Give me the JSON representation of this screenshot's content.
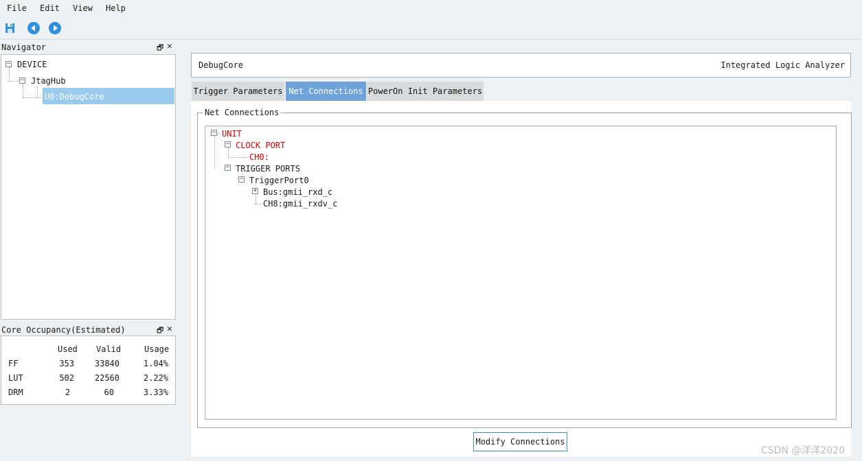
{
  "menu": {
    "file": "File",
    "edit": "Edit",
    "view": "View",
    "help": "Help"
  },
  "toolbar": {
    "save_icon": "floppy-disk-icon",
    "back_icon": "arrow-left-circle-icon",
    "forward_icon": "arrow-right-circle-icon",
    "accent": "#2f8fe0"
  },
  "navigator": {
    "title": "Navigator",
    "tree": {
      "device": "DEVICE",
      "hub": "JtagHub",
      "core": "U0:DebugCore"
    }
  },
  "occupancy": {
    "title": "Core Occupancy(Estimated)",
    "headers": [
      "Used",
      "Valid",
      "Usage"
    ],
    "rows": [
      {
        "name": "FF",
        "used": "353",
        "valid": "33840",
        "usage": "1.04%"
      },
      {
        "name": "LUT",
        "used": "502",
        "valid": "22560",
        "usage": "2.22%"
      },
      {
        "name": "DRM",
        "used": "2",
        "valid": "60",
        "usage": "3.33%"
      }
    ]
  },
  "header": {
    "left": "DebugCore",
    "right": "Integrated Logic Analyzer"
  },
  "tabs": [
    "Trigger Parameters",
    "Net Connections",
    "PowerOn Init Parameters"
  ],
  "net_connections": {
    "group_title": "Net Connections",
    "tree": {
      "unit": "UNIT",
      "clock_port": "CLOCK PORT",
      "ch0": "CH0:",
      "trigger_ports": "TRIGGER PORTS",
      "trigger_port0": "TriggerPort0",
      "bus": "Bus:gmii_rxd_c",
      "ch8": "CH8:gmii_rxdv_c"
    },
    "modify_button": "Modify Connections"
  },
  "watermark": "CSDN @洋洋2020",
  "colors": {
    "selection": "#99cbef",
    "active_tab": "#6fa3dc",
    "error_red": "#e00000"
  }
}
